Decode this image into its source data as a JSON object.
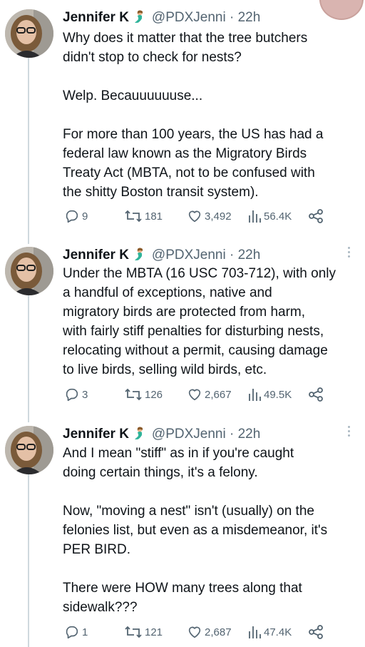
{
  "tweets": [
    {
      "name": "Jennifer K",
      "handle": "@PDXJenni",
      "sep": "·",
      "time": "22h",
      "text": "Why does it matter that the tree butchers\ndidn't stop to check for nests?\n\nWelp. Becauuuuuuse...\n\nFor more than 100 years, the US has had a\nfederal law known as the Migratory Birds\nTreaty Act (MBTA, not to be confused with\nthe shitty Boston transit system).",
      "replies": "9",
      "retweets": "181",
      "likes": "3,492",
      "views": "56.4K"
    },
    {
      "name": "Jennifer K",
      "handle": "@PDXJenni",
      "sep": "·",
      "time": "22h",
      "text": "Under the MBTA (16 USC 703-712), with only\na handful of exceptions, native and\nmigratory birds are protected from harm,\nwith fairly stiff penalties for disturbing nests,\nrelocating without a permit, causing damage\nto live birds, selling wild birds, etc.",
      "replies": "3",
      "retweets": "126",
      "likes": "2,667",
      "views": "49.5K"
    },
    {
      "name": "Jennifer K",
      "handle": "@PDXJenni",
      "sep": "·",
      "time": "22h",
      "text": "And I mean \"stiff\" as in if you're caught\ndoing certain things, it's a felony.\n\nNow, \"moving a nest\" isn't (usually) on the\nfelonies list, but even as a misdemeanor, it's\nPER BIRD.\n\nThere were HOW many trees along that\nsidewalk???",
      "replies": "1",
      "retweets": "121",
      "likes": "2,687",
      "views": "47.4K"
    }
  ],
  "icons": {
    "reply": "reply-icon",
    "retweet": "retweet-icon",
    "like": "heart-icon",
    "views": "views-icon",
    "share": "share-icon",
    "more": "more-options-icon",
    "badge": "mermaid-emoji-icon"
  },
  "colors": {
    "text": "#0f1419",
    "secondary": "#536471",
    "thread_line": "#cfd9de"
  }
}
